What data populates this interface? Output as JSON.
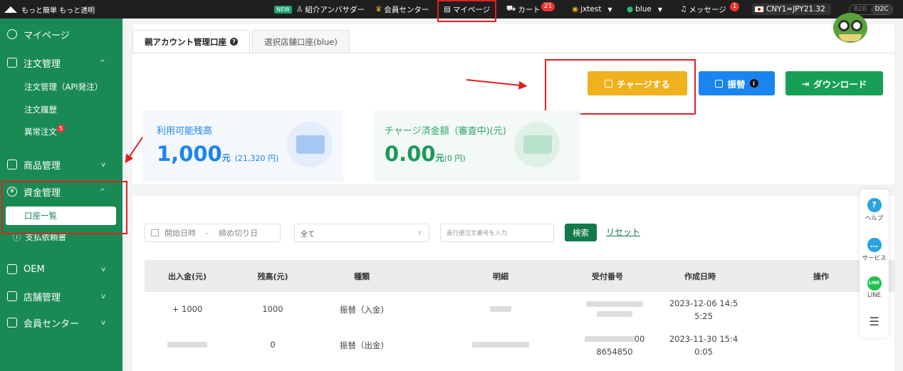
{
  "topbar": {
    "brand": "もっと簡単 もっと透明",
    "new_tag": "NEW",
    "ambassador": "紹介アンバサダー",
    "member_center": "会員センター",
    "mypage": "マイページ",
    "cart": "カート",
    "cart_count": "21",
    "user": "jxtest",
    "shop": "blue",
    "messages": "メッセージ",
    "messages_count": "1",
    "rate": "CNY1=JPY21.32",
    "b2b": "B2B",
    "d2c": "D2C"
  },
  "sidebar": {
    "mypage": "マイページ",
    "order_mgmt": "注文管理",
    "order_api": "注文管理（API発注）",
    "order_history": "注文履歴",
    "abnormal_order": "異常注文",
    "abnormal_count": "5",
    "product_mgmt": "商品管理",
    "fund_mgmt": "資金管理",
    "account_list": "口座一覧",
    "payment_request": "支払依頼書",
    "oem": "OEM",
    "store_mgmt": "店舗管理",
    "member_center": "会員センター"
  },
  "tabs": {
    "parent": "親アカウント管理口座",
    "selected_store": "選択店舗口座(blue)"
  },
  "actions": {
    "charge": "チャージする",
    "transfer": "振替",
    "download": "ダウンロード"
  },
  "balance": {
    "available_label": "利用可能残高",
    "available_amount": "1,000",
    "available_unit": "元",
    "available_jpy": "(21,320 円)",
    "charged_label": "チャージ済金額（審査中)(元)",
    "charged_amount": "0.00",
    "charged_unit": "元",
    "charged_jpy": "(0 円)"
  },
  "filters": {
    "start": "開始日時",
    "dash": "-",
    "end": "締め切り日",
    "type": "全て",
    "order_placeholder": "直行便注文番号を入力",
    "search": "検索",
    "reset": "リセット"
  },
  "table": {
    "headers": [
      "出入金(元)",
      "残高(元)",
      "種類",
      "明細",
      "受付番号",
      "作成日時",
      "操作"
    ],
    "rows": [
      {
        "amount": "+ 1000",
        "balance": "1000",
        "type": "振替（入金)",
        "receipt_a": "",
        "receipt_b": "",
        "created": "2023-12-06 14:5",
        "created2": "5:25"
      },
      {
        "amount": "",
        "balance": "0",
        "type": "振替（出金)",
        "receipt_a": "00",
        "receipt_b": "8654850",
        "created": "2023-11-30 15:4",
        "created2": "0:05"
      }
    ]
  },
  "float_bar": {
    "help": "ヘルプ",
    "service": "サービス",
    "line": "LINE",
    "line_icon": "LINE"
  }
}
